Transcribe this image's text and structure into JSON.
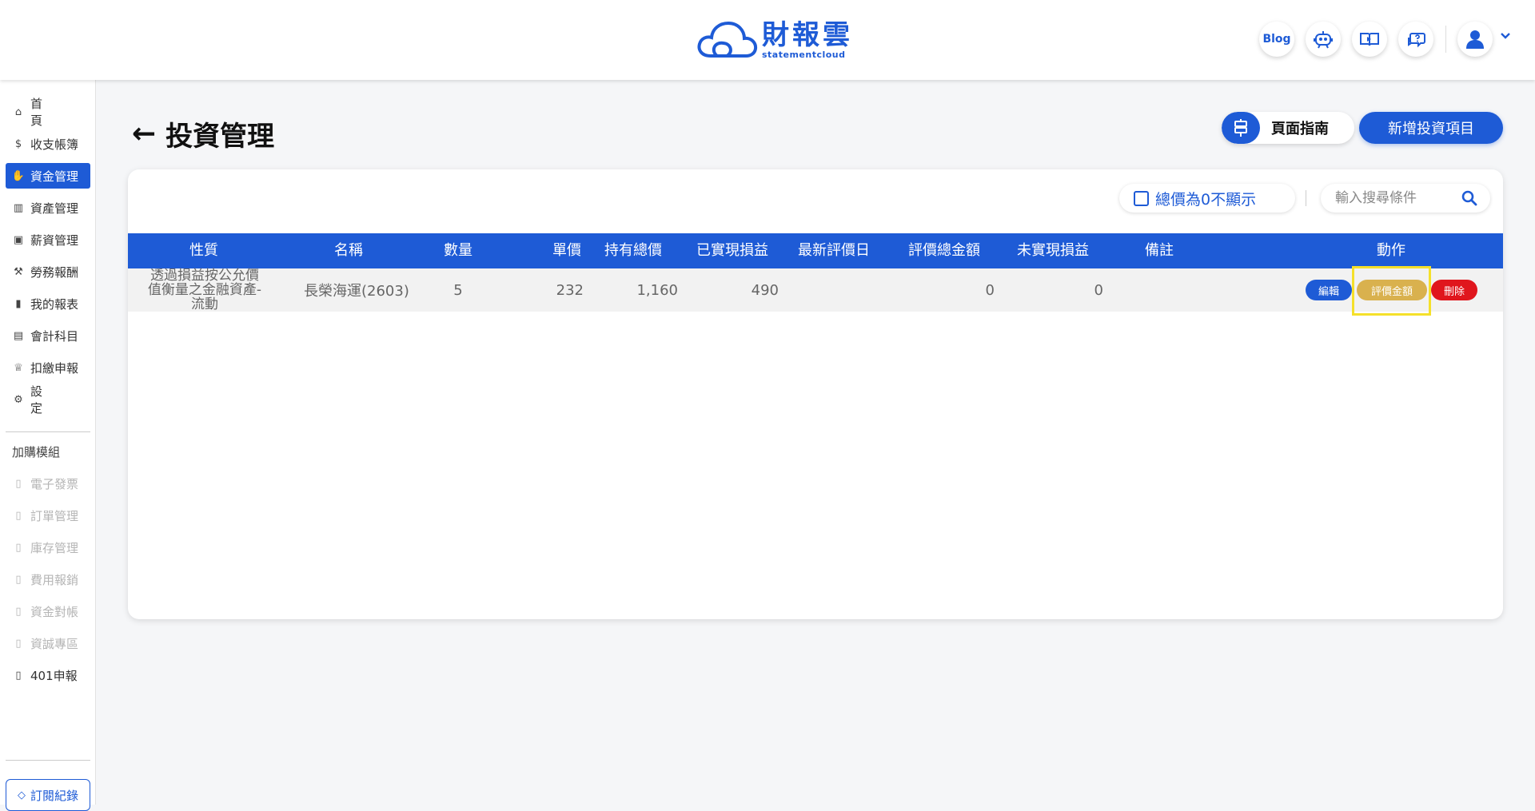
{
  "header": {
    "logo_cn": "財報雲",
    "logo_en": "statementcloud",
    "blog_label": "Blog",
    "icons": [
      "robot-icon",
      "video-book-icon",
      "help-chat-icon",
      "user-avatar-icon",
      "chevron-down-icon"
    ]
  },
  "sidebar": {
    "items": [
      {
        "label": "首頁",
        "icon": "home-icon"
      },
      {
        "label": "收支帳簿",
        "icon": "coin-icon"
      },
      {
        "label": "資金管理",
        "icon": "hand-coin-icon"
      },
      {
        "label": "資產管理",
        "icon": "bar-chart-icon"
      },
      {
        "label": "薪資管理",
        "icon": "payroll-icon"
      },
      {
        "label": "勞務報酬",
        "icon": "worker-icon"
      },
      {
        "label": "我的報表",
        "icon": "report-icon"
      },
      {
        "label": "會計科目",
        "icon": "ledger-icon"
      },
      {
        "label": "扣繳申報",
        "icon": "tax-icon"
      },
      {
        "label": "設定",
        "icon": "settings-sliders-icon"
      }
    ],
    "addon_title": "加購模組",
    "addons": [
      {
        "label": "電子發票"
      },
      {
        "label": "訂單管理"
      },
      {
        "label": "庫存管理"
      },
      {
        "label": "費用報銷"
      },
      {
        "label": "資金對帳"
      },
      {
        "label": "資誠專區"
      },
      {
        "label": "401申報"
      }
    ],
    "subscription_label": "訂閱紀錄"
  },
  "main": {
    "title": "投資管理",
    "guide_label": "頁面指南",
    "add_label": "新增投資項目",
    "hide_zero_label": "總價為0不顯示",
    "search_placeholder": "輸入搜尋條件",
    "columns": [
      "性質",
      "名稱",
      "數量",
      "單價",
      "持有總價",
      "已實現損益",
      "最新評價日",
      "評價總金額",
      "未實現損益",
      "備註",
      "動作"
    ],
    "rows": [
      {
        "nature": "透過損益按公允價值衡量之金融資產-流動",
        "name": "長榮海運(2603)",
        "quantity": "5",
        "unit_price": "232",
        "total_held": "1,160",
        "realized": "490",
        "latest_eval_date": "",
        "eval_total": "0",
        "unrealized": "0",
        "note": "",
        "actions": {
          "edit": "編輯",
          "eval": "評價金額",
          "delete": "刪除"
        }
      }
    ]
  },
  "colors": {
    "primary": "#1e5bd6",
    "eval_button": "#d9b14e",
    "delete_button": "#e0161d",
    "highlight": "#f5e02a"
  }
}
